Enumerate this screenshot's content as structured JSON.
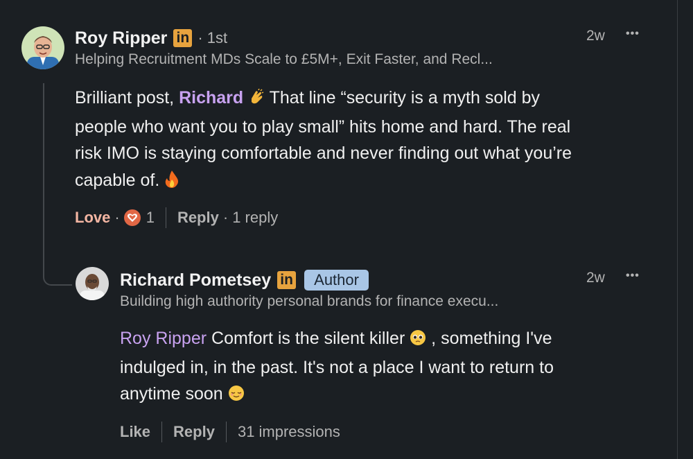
{
  "comment": {
    "author": "Roy Ripper",
    "linkedin_badge": "in",
    "degree": "· 1st",
    "headline": "Helping Recruitment MDs Scale to £5M+, Exit Faster, and Recl...",
    "time": "2w",
    "more": "•••",
    "text_line1_before": "Brilliant post,",
    "mention": "Richard",
    "text_line1_after": "That line “security is a myth sold by",
    "text_line2": "people who want you to play small” hits home and hard. The real",
    "text_line3": "risk IMO is staying comfortable and never finding out what you’re",
    "text_line4": "capable of.",
    "reaction_label": "Love",
    "reaction_count": "1",
    "reply_label": "Reply",
    "reply_count": "1 reply"
  },
  "reply": {
    "author": "Richard Pometsey",
    "linkedin_badge": "in",
    "author_badge": "Author",
    "headline": "Building high authority personal brands for finance execu...",
    "time": "2w",
    "more": "•••",
    "mention": "Roy Ripper",
    "text_line1": "Comfort is the silent killer",
    "text_line1_after": ", something I've",
    "text_line2": "indulged in, in the past. It's not a place I want to return to",
    "text_line3": "anytime soon",
    "like_label": "Like",
    "reply_label": "Reply",
    "impressions": "31 impressions"
  },
  "colors": {
    "background": "#1b1f23",
    "mention": "#c8a2f0",
    "linkedin_badge": "#e7a33e",
    "author_badge": "#a9c6e6",
    "love": "#f4b6a3"
  },
  "icons": {
    "clap": "clapping-hands-emoji",
    "fire": "fire-emoji",
    "pleading": "pleading-face-emoji",
    "relieved": "relieved-face-emoji",
    "heart": "heart-reaction-icon"
  }
}
